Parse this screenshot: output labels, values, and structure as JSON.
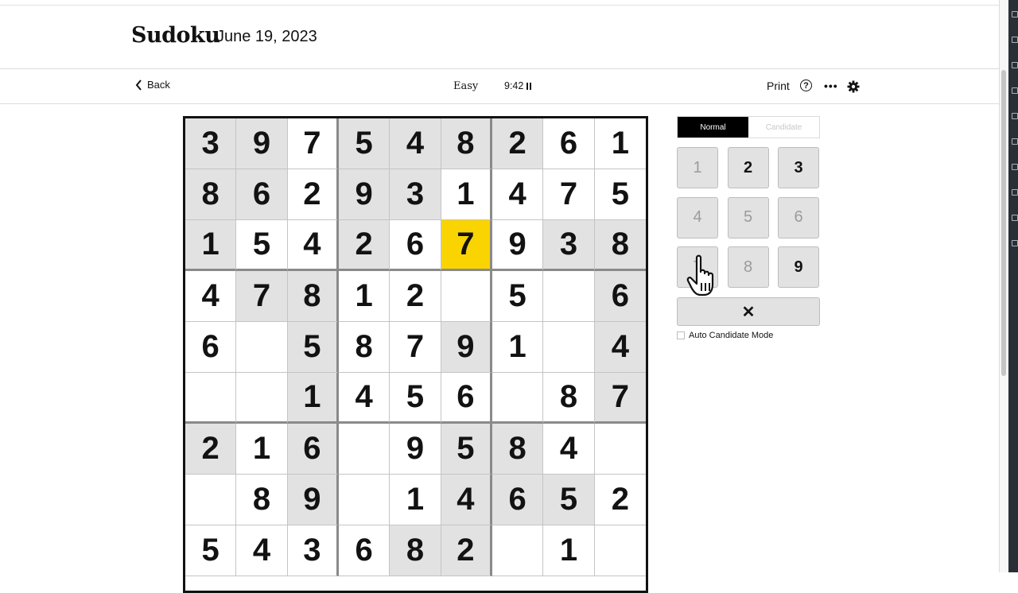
{
  "header": {
    "title": "Sudoku",
    "date": "June 19, 2023"
  },
  "toolbar": {
    "back_label": "Back",
    "difficulty": "Easy",
    "timer": "9:42",
    "print_label": "Print",
    "help_glyph": "?",
    "more_glyph": "•••"
  },
  "icons": [
    "chevron-left-icon",
    "pause-icon",
    "help-icon",
    "more-icon",
    "gear-icon",
    "close-icon",
    "hand-cursor-icon"
  ],
  "colors": {
    "selected": "#fad400",
    "given": "#e2e2e2",
    "mode_active": "#000000"
  },
  "board": {
    "rows": [
      [
        "3",
        "9",
        "7",
        "5",
        "4",
        "8",
        "2",
        "6",
        "1"
      ],
      [
        "8",
        "6",
        "2",
        "9",
        "3",
        "1",
        "4",
        "7",
        "5"
      ],
      [
        "1",
        "5",
        "4",
        "2",
        "6",
        "7",
        "9",
        "3",
        "8"
      ],
      [
        "4",
        "7",
        "8",
        "1",
        "2",
        "",
        "5",
        "",
        "6"
      ],
      [
        "6",
        "",
        "5",
        "8",
        "7",
        "9",
        "1",
        "",
        "4"
      ],
      [
        "",
        "",
        "1",
        "4",
        "5",
        "6",
        "",
        "8",
        "7"
      ],
      [
        "2",
        "1",
        "6",
        "",
        "9",
        "5",
        "8",
        "4",
        ""
      ],
      [
        "",
        "8",
        "9",
        "",
        "1",
        "4",
        "6",
        "5",
        "2"
      ],
      [
        "5",
        "4",
        "3",
        "6",
        "8",
        "2",
        "",
        "1",
        ""
      ]
    ],
    "given": [
      [
        1,
        1,
        0,
        1,
        1,
        1,
        1,
        0,
        0
      ],
      [
        1,
        1,
        0,
        1,
        1,
        0,
        0,
        0,
        0
      ],
      [
        1,
        0,
        0,
        1,
        0,
        0,
        0,
        1,
        1
      ],
      [
        0,
        1,
        1,
        0,
        0,
        0,
        0,
        0,
        1
      ],
      [
        0,
        0,
        1,
        0,
        0,
        1,
        0,
        0,
        1
      ],
      [
        0,
        0,
        1,
        0,
        0,
        0,
        0,
        0,
        1
      ],
      [
        1,
        0,
        1,
        0,
        0,
        1,
        1,
        0,
        0
      ],
      [
        0,
        0,
        1,
        0,
        0,
        1,
        1,
        1,
        0
      ],
      [
        0,
        0,
        0,
        0,
        1,
        1,
        0,
        0,
        0
      ]
    ],
    "selected": {
      "row": 2,
      "col": 5
    }
  },
  "controls": {
    "mode_normal": "Normal",
    "mode_candidate": "Candidate",
    "active_mode": "Normal",
    "numbers": [
      {
        "label": "1",
        "state": "used"
      },
      {
        "label": "2",
        "state": "available"
      },
      {
        "label": "3",
        "state": "available"
      },
      {
        "label": "4",
        "state": "used"
      },
      {
        "label": "5",
        "state": "used"
      },
      {
        "label": "6",
        "state": "used"
      },
      {
        "label": "7",
        "state": "used"
      },
      {
        "label": "8",
        "state": "used"
      },
      {
        "label": "9",
        "state": "available"
      }
    ],
    "clear_glyph": "✕",
    "auto_candidate_label": "Auto Candidate Mode",
    "auto_candidate_checked": false
  }
}
